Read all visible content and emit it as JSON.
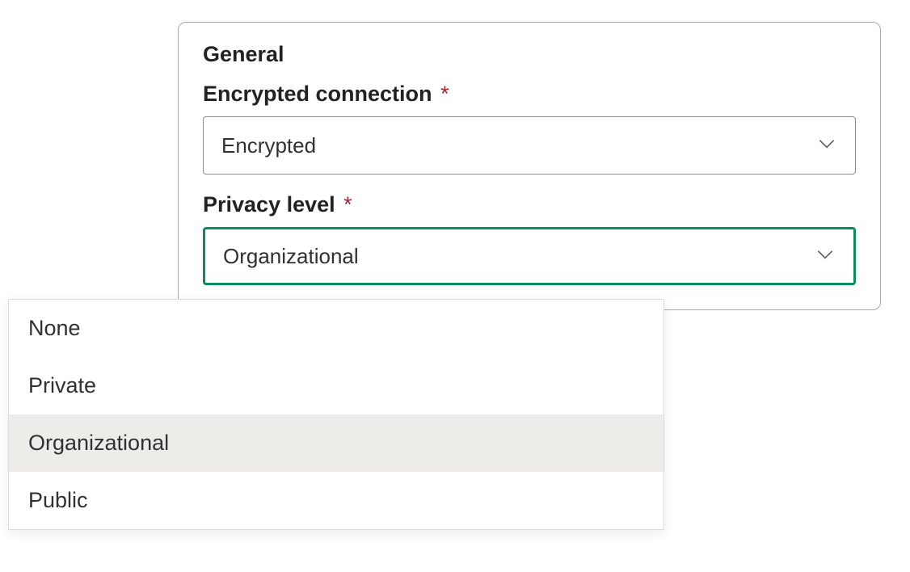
{
  "panel": {
    "section_title": "General",
    "encrypted_connection": {
      "label": "Encrypted connection",
      "required_marker": "*",
      "value": "Encrypted"
    },
    "privacy_level": {
      "label": "Privacy level",
      "required_marker": "*",
      "value": "Organizational",
      "options": [
        "None",
        "Private",
        "Organizational",
        "Public"
      ],
      "selected_index": 2
    }
  },
  "colors": {
    "accent": "#0d8a5f",
    "required": "#a4262c",
    "border": "#8a8a8a"
  }
}
